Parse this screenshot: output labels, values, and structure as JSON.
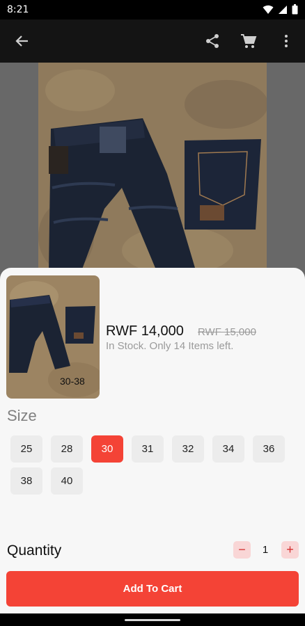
{
  "status_bar": {
    "time": "8:21"
  },
  "app_bar": {
    "icons": [
      "back-arrow-icon",
      "share-icon",
      "cart-icon",
      "more-vert-icon"
    ]
  },
  "product": {
    "thumb_label": "30-38",
    "price": "RWF 14,000",
    "old_price": "RWF 15,000",
    "stock_text": "In Stock. Only 14 Items left."
  },
  "size": {
    "title": "Size",
    "options": [
      "25",
      "28",
      "30",
      "31",
      "32",
      "34",
      "36",
      "38",
      "40"
    ],
    "selected": "30"
  },
  "quantity": {
    "label": "Quantity",
    "value": "1",
    "minus": "−",
    "plus": "+"
  },
  "actions": {
    "add_to_cart": "Add To Cart"
  },
  "colors": {
    "accent": "#f44336",
    "accent_light": "#f9d6d6",
    "sheet_bg": "#f7f7f7"
  }
}
